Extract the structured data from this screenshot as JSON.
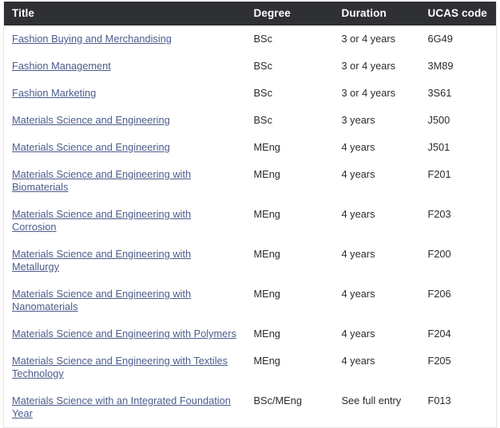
{
  "table": {
    "name": "course-listing-table",
    "colors": {
      "header_background": "#2f3033",
      "header_text": "#ffffff",
      "link_text": "#4c5c8c",
      "body_text": "#2b2b2b",
      "table_border": "#e6e6e6",
      "page_background": "#ffffff"
    },
    "columns": [
      {
        "key": "title",
        "label": "Title"
      },
      {
        "key": "degree",
        "label": "Degree"
      },
      {
        "key": "duration",
        "label": "Duration"
      },
      {
        "key": "ucas",
        "label": "UCAS code"
      }
    ],
    "rows": [
      {
        "title": "Fashion Buying and Merchandising",
        "degree": "BSc",
        "duration": "3 or 4 years",
        "ucas": "6G49"
      },
      {
        "title": "Fashion Management",
        "degree": "BSc",
        "duration": "3 or 4 years",
        "ucas": "3M89"
      },
      {
        "title": "Fashion Marketing",
        "degree": "BSc",
        "duration": "3 or 4 years",
        "ucas": "3S61"
      },
      {
        "title": "Materials Science and Engineering",
        "degree": "BSc",
        "duration": "3 years",
        "ucas": "J500"
      },
      {
        "title": "Materials Science and Engineering",
        "degree": "MEng",
        "duration": "4 years",
        "ucas": "J501"
      },
      {
        "title": "Materials Science and Engineering with Biomaterials",
        "degree": "MEng",
        "duration": "4 years",
        "ucas": "F201"
      },
      {
        "title": "Materials Science and Engineering with Corrosion",
        "degree": "MEng",
        "duration": "4 years",
        "ucas": "F203"
      },
      {
        "title": "Materials Science and Engineering with Metallurgy",
        "degree": "MEng",
        "duration": "4 years",
        "ucas": "F200"
      },
      {
        "title": "Materials Science and Engineering with Nanomaterials",
        "degree": "MEng",
        "duration": "4 years",
        "ucas": "F206"
      },
      {
        "title": "Materials Science and Engineering with Polymers",
        "degree": "MEng",
        "duration": "4 years",
        "ucas": "F204"
      },
      {
        "title": "Materials Science and Engineering with Textiles Technology",
        "degree": "MEng",
        "duration": "4 years",
        "ucas": "F205"
      },
      {
        "title": "Materials Science with an Integrated Foundation Year",
        "degree": "BSc/MEng",
        "duration": "See full entry",
        "ucas": "F013"
      }
    ]
  }
}
